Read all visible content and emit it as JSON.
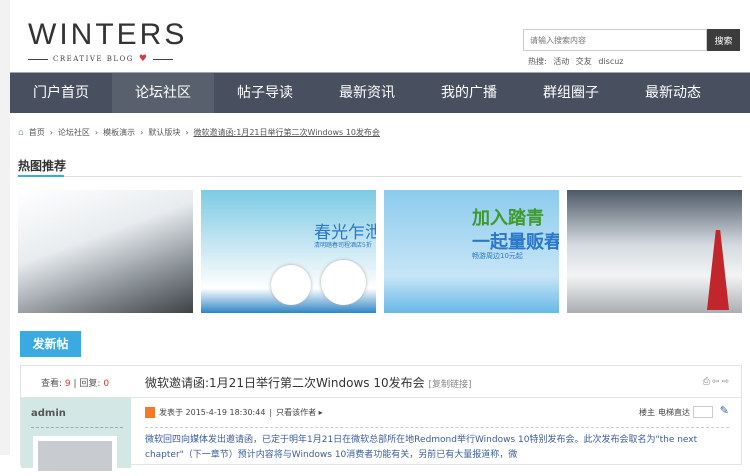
{
  "logo": {
    "title": "WINTERS",
    "subtitle": "CREATIVE BLOG"
  },
  "search": {
    "placeholder": "请输入搜索内容",
    "button": "搜索",
    "hot_label": "热搜:",
    "hot": [
      "活动",
      "交友",
      "discuz"
    ]
  },
  "nav": [
    "门户首页",
    "论坛社区",
    "帖子导读",
    "最新资讯",
    "我的广播",
    "群组圈子",
    "最新动态"
  ],
  "breadcrumb": [
    "首页",
    "论坛社区",
    "模板演示",
    "默认版块",
    "微软邀请函:1月21日举行第二次Windows 10发布会"
  ],
  "section_title": "热图推荐",
  "banners": {
    "b2_title": "春光乍泄",
    "b2_sub": "清明踏春司程酒店5折",
    "b3_title": "加入踏青",
    "b3_title2": "一起量贩春",
    "b3_sub": "畅游周边10元起"
  },
  "new_post": "发新帖",
  "post": {
    "views_label": "查看:",
    "views": "9",
    "replies_label": "回复:",
    "replies": "0",
    "title": "微软邀请函:1月21日举行第二次Windows 10发布会",
    "copy_link": "[复制链接]",
    "author": "admin",
    "posted": "发表于 2015-4-19 18:30:44",
    "only_author": "只看该作者 ▸",
    "floor": "楼主",
    "jump_label": "电梯直达",
    "body": "微软回四向媒体发出邀请函，已定于明年1月21日在微软总部所在地Redmond举行Windows 10特别发布会。此次发布会取名为\"the next chapter\"（下一章节）预计内容将与Windows 10消费者功能有关，另前已有大量报道称，微"
  }
}
